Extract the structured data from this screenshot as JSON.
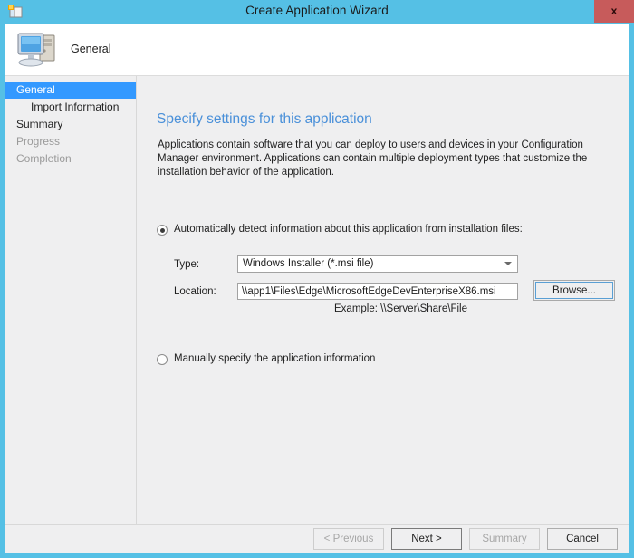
{
  "window": {
    "title": "Create Application Wizard",
    "close_label": "x",
    "title_icon": "application-wizard-icon",
    "accent_color": "#55c0e5",
    "close_color": "#c75b5b"
  },
  "header": {
    "label": "General",
    "icon": "computer-icon"
  },
  "sidebar": {
    "items": [
      {
        "label": "General",
        "state": "selected",
        "indent": false
      },
      {
        "label": "Import Information",
        "state": "normal",
        "indent": true
      },
      {
        "label": "Summary",
        "state": "normal",
        "indent": false
      },
      {
        "label": "Progress",
        "state": "dim",
        "indent": false
      },
      {
        "label": "Completion",
        "state": "dim",
        "indent": false
      }
    ],
    "selected_color": "#3399ff"
  },
  "content": {
    "heading": "Specify settings for this application",
    "heading_color": "#4a90d9",
    "description": "Applications contain software that you can deploy to users and devices in your Configuration Manager environment. Applications can contain multiple deployment types that customize the installation behavior of the application.",
    "auto_detect_option": {
      "label": "Automatically detect information about this application from installation files:",
      "checked": true
    },
    "manual_option": {
      "label": "Manually specify the application information",
      "checked": false
    },
    "type_field": {
      "label": "Type:",
      "value": "Windows Installer (*.msi file)",
      "arrow_icon": "chevron-down-icon"
    },
    "location_field": {
      "label": "Location:",
      "value": "\\\\app1\\Files\\Edge\\MicrosoftEdgeDevEnterpriseX86.msi",
      "placeholder": ""
    },
    "example_hint": "Example: \\\\Server\\Share\\File",
    "browse_label": "Browse..."
  },
  "footer": {
    "previous_label": "< Previous",
    "next_label": "Next >",
    "summary_label": "Summary",
    "cancel_label": "Cancel"
  }
}
